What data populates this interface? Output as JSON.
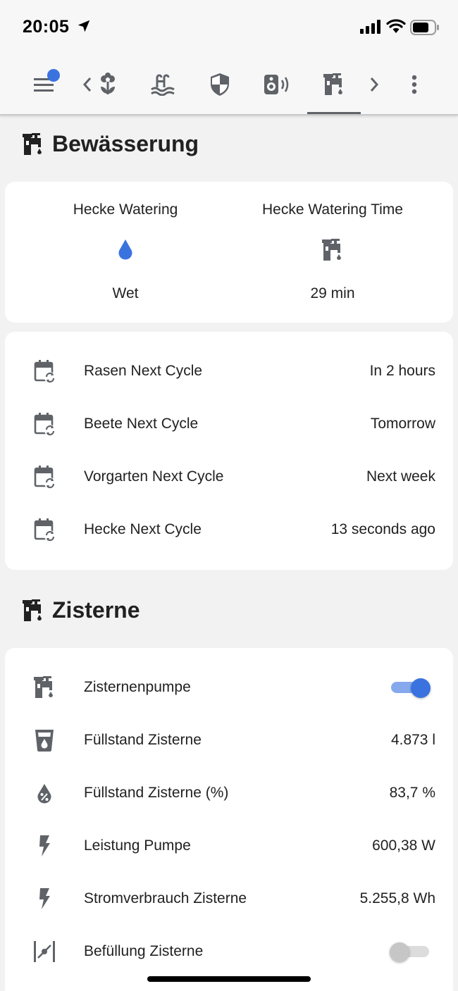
{
  "status_bar": {
    "time": "20:05"
  },
  "colors": {
    "accent": "#3a73e0",
    "icon": "#5f6368",
    "background": "#f2f2f2",
    "card": "#ffffff"
  },
  "toolbar": {
    "icons": [
      "menu-icon",
      "chevron-left-icon",
      "flower-icon",
      "pool-icon",
      "shield-icon",
      "speaker-icon",
      "water-pump-icon",
      "chevron-right-icon",
      "more-vert-icon"
    ],
    "active_tab": "water-pump-icon"
  },
  "sections": {
    "bewaesserung": {
      "title": "Bewässerung",
      "glance": [
        {
          "name": "Hecke Watering",
          "icon": "water-drop-icon",
          "state": "Wet"
        },
        {
          "name": "Hecke Watering Time",
          "icon": "water-pump-icon",
          "state": "29 min"
        }
      ],
      "rows": [
        {
          "label": "Rasen Next Cycle",
          "value": "In 2 hours",
          "icon": "calendar-sync-icon"
        },
        {
          "label": "Beete Next Cycle",
          "value": "Tomorrow",
          "icon": "calendar-sync-icon"
        },
        {
          "label": "Vorgarten Next Cycle",
          "value": "Next week",
          "icon": "calendar-sync-icon"
        },
        {
          "label": "Hecke Next Cycle",
          "value": "13 seconds ago",
          "icon": "calendar-sync-icon"
        }
      ]
    },
    "zisterne": {
      "title": "Zisterne",
      "rows": [
        {
          "label": "Zisternenpumpe",
          "toggle": "on",
          "icon": "water-pump-icon"
        },
        {
          "label": "Füllstand Zisterne",
          "value": "4.873 l",
          "icon": "cup-water-icon"
        },
        {
          "label": "Füllstand Zisterne (%)",
          "value": "83,7 %",
          "icon": "water-percent-icon"
        },
        {
          "label": "Leistung Pumpe",
          "value": "600,38 W",
          "icon": "flash-icon"
        },
        {
          "label": "Stromverbrauch Zisterne",
          "value": "5.255,8 Wh",
          "icon": "flash-icon"
        },
        {
          "label": "Befüllung Zisterne",
          "toggle": "off",
          "icon": "valve-icon"
        }
      ]
    }
  }
}
